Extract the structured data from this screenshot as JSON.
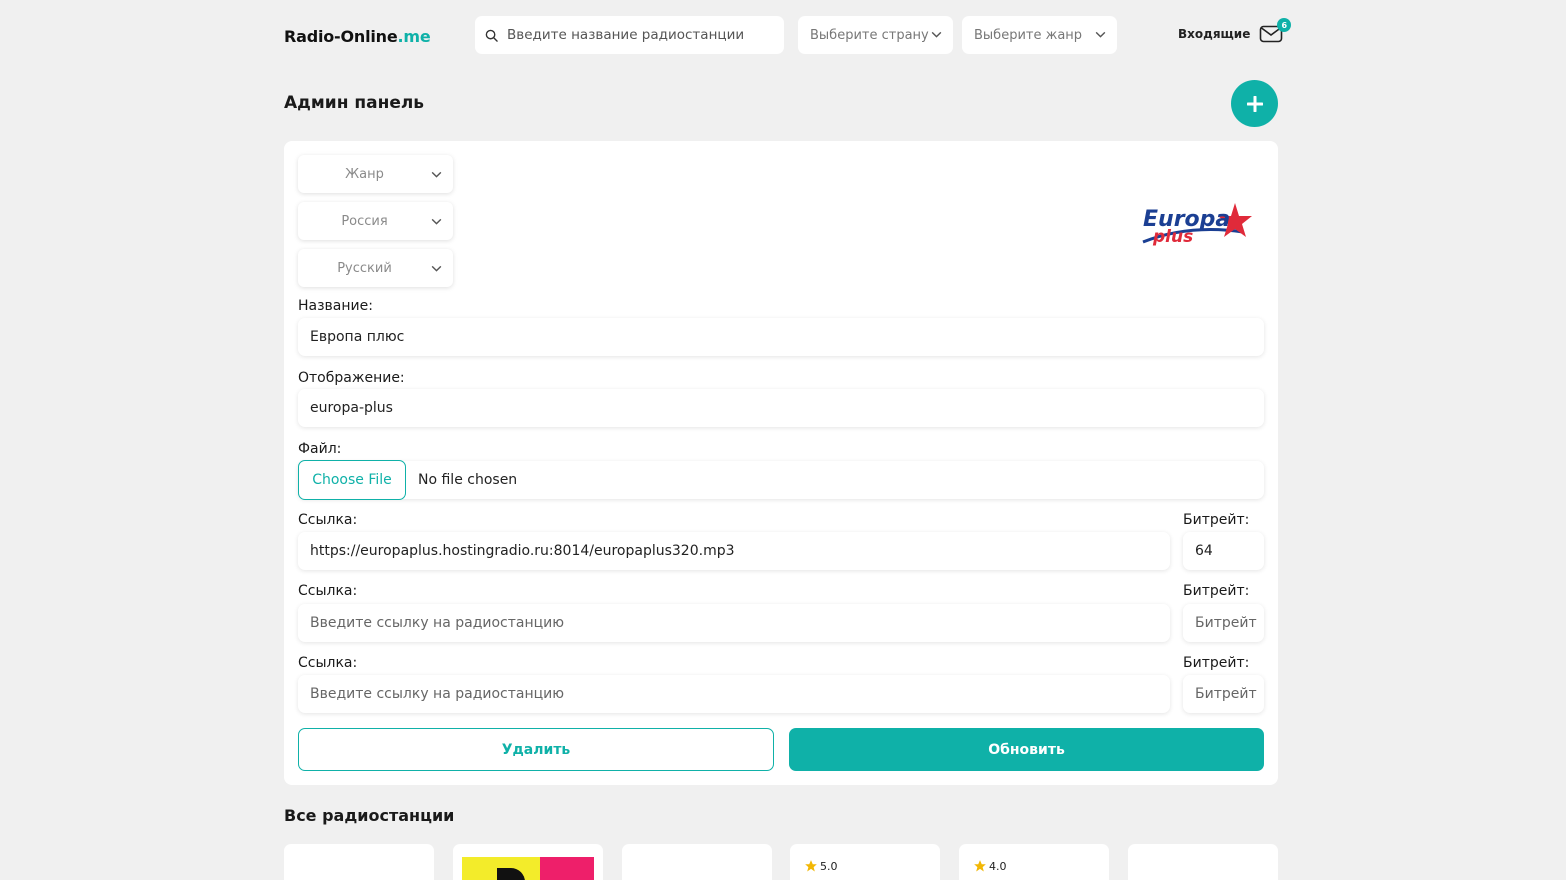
{
  "header": {
    "logo_main": "Radio-Online",
    "logo_accent": ".me",
    "search_placeholder": "Введите название радиостанции",
    "country_select": "Выберите страну",
    "genre_select": "Выберите жанр",
    "inbox_label": "Входящие",
    "inbox_count": "6"
  },
  "page": {
    "title": "Админ панель"
  },
  "form": {
    "genre": "Жанр",
    "country": "Россия",
    "language": "Русский",
    "name_label": "Название:",
    "name_value": "Европа плюс",
    "slug_label": "Отображение:",
    "slug_value": "europa-plus",
    "file_label": "Файл:",
    "choose_file": "Choose File",
    "no_file": "No file chosen",
    "streams": [
      {
        "url_label": "Ссылка:",
        "url_value": "https://europaplus.hostingradio.ru:8014/europaplus320.mp3",
        "url_placeholder": "Введите ссылку на радиостанцию",
        "bitrate_label": "Битрейт:",
        "bitrate_value": "64",
        "bitrate_placeholder": "Битрейт"
      },
      {
        "url_label": "Ссылка:",
        "url_value": "",
        "url_placeholder": "Введите ссылку на радиостанцию",
        "bitrate_label": "Битрейт:",
        "bitrate_value": "",
        "bitrate_placeholder": "Битрейт"
      },
      {
        "url_label": "Ссылка:",
        "url_value": "",
        "url_placeholder": "Введите ссылку на радиостанцию",
        "bitrate_label": "Битрейт:",
        "bitrate_value": "",
        "bitrate_placeholder": "Битрейт"
      }
    ],
    "delete_label": "Удалить",
    "update_label": "Обновить",
    "logo_text_line1": "Europa",
    "logo_text_line2": "plus"
  },
  "stations": {
    "title": "Все радиостанции",
    "ratings": [
      "5.0",
      "4.0"
    ]
  },
  "colors": {
    "accent": "#0fb1a8",
    "background": "#f0f0f0",
    "star": "#f2b705"
  }
}
